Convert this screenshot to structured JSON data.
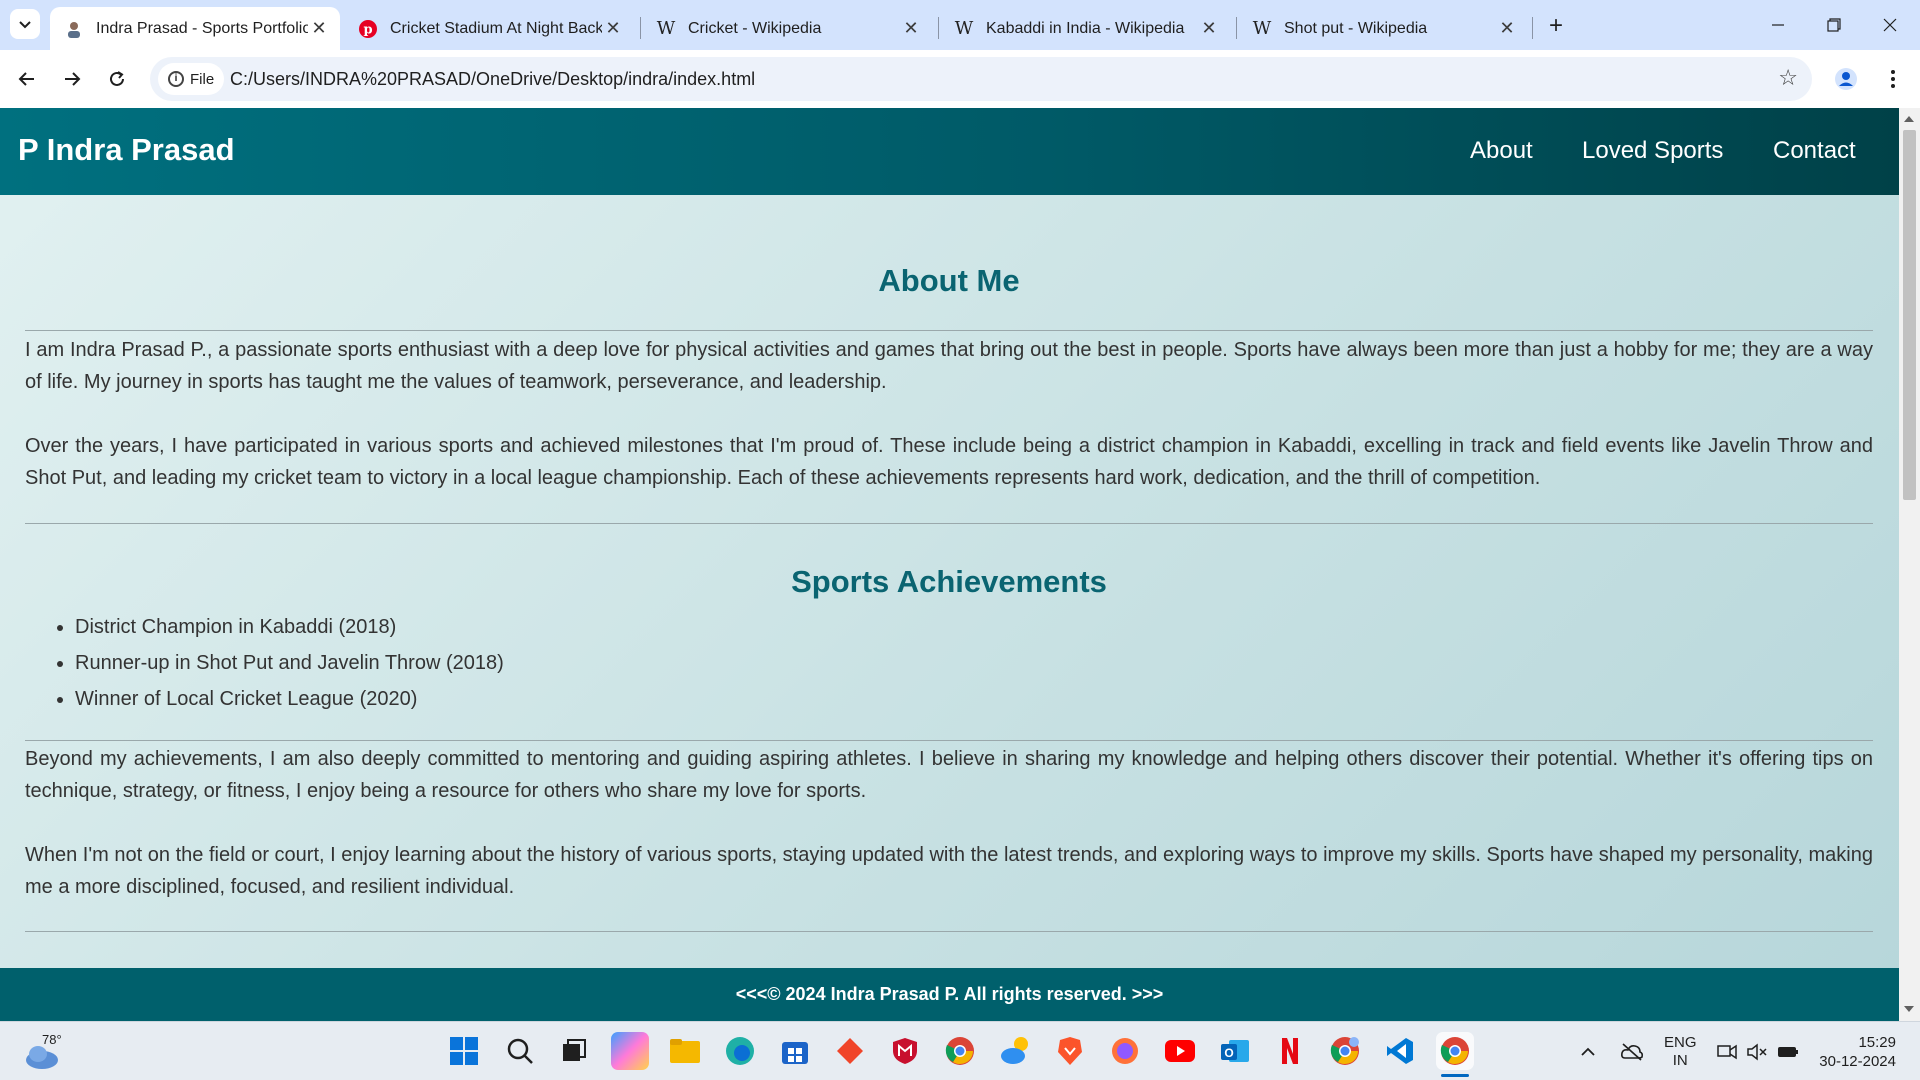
{
  "browser": {
    "tabs": [
      {
        "title": "Indra Prasad - Sports Portfolio",
        "active": true,
        "favicon": "person-icon"
      },
      {
        "title": "Cricket Stadium At Night Backg",
        "active": false,
        "favicon": "pinterest-icon"
      },
      {
        "title": "Cricket - Wikipedia",
        "active": false,
        "favicon": "wikipedia-icon"
      },
      {
        "title": "Kabaddi in India - Wikipedia",
        "active": false,
        "favicon": "wikipedia-icon"
      },
      {
        "title": "Shot put - Wikipedia",
        "active": false,
        "favicon": "wikipedia-icon"
      }
    ],
    "omnibox": {
      "chip_label": "File",
      "url": "C:/Users/INDRA%20PRASAD/OneDrive/Desktop/indra/index.html"
    }
  },
  "site": {
    "brand": "P Indra Prasad",
    "nav": [
      "About",
      "Loved Sports",
      "Contact"
    ],
    "about": {
      "heading": "About Me",
      "p1": "I am Indra Prasad P., a passionate sports enthusiast with a deep love for physical activities and games that bring out the best in people. Sports have always been more than just a hobby for me; they are a way of life. My journey in sports has taught me the values of teamwork, perseverance, and leadership.",
      "p2": "Over the years, I have participated in various sports and achieved milestones that I'm proud of. These include being a district champion in Kabaddi, excelling in track and field events like Javelin Throw and Shot Put, and leading my cricket team to victory in a local league championship. Each of these achievements represents hard work, dedication, and the thrill of competition."
    },
    "achievements": {
      "heading": "Sports Achievements",
      "items": [
        "District Champion in Kabaddi (2018)",
        "Runner-up in Shot Put and Javelin Throw (2018)",
        "Winner of Local Cricket League (2020)"
      ]
    },
    "more": {
      "p1": "Beyond my achievements, I am also deeply committed to mentoring and guiding aspiring athletes. I believe in sharing my knowledge and helping others discover their potential. Whether it's offering tips on technique, strategy, or fitness, I enjoy being a resource for others who share my love for sports.",
      "p2": "When I'm not on the field or court, I enjoy learning about the history of various sports, staying updated with the latest trends, and exploring ways to improve my skills. Sports have shaped my personality, making me a more disciplined, focused, and resilient individual."
    },
    "footer": "<<<© 2024 Indra Prasad P. All rights reserved. >>>"
  },
  "taskbar": {
    "weather": "78°",
    "language": "ENG",
    "region": "IN",
    "time": "15:29",
    "date": "30-12-2024"
  },
  "colors": {
    "header_bg": "#00707f",
    "heading": "#0a6471",
    "footer_bg": "#00606c"
  }
}
